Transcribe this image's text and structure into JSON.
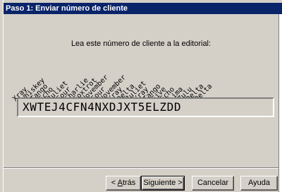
{
  "window": {
    "title": "Paso 1: Enviar número de cliente"
  },
  "instruction": "Lea este número de cliente a la editorial:",
  "phonetic_words": [
    "Xray",
    "Whiskey",
    "Tango",
    "Echo",
    "Juliet",
    "Four",
    "Charlie",
    "Foxtrot",
    "November",
    "Four",
    "November",
    "Xray",
    "Delta",
    "Juliet",
    "Xray",
    "Tango",
    "Five",
    "Echo",
    "Lima",
    "Zulu",
    "Delta",
    "Delta"
  ],
  "customer_code": "XWTEJ4CFN4NXDJXT5ELZDD",
  "buttons": {
    "back_prefix": "< ",
    "back_accel": "A",
    "back_rest": "trás",
    "next": "Siguiente >",
    "cancel": "Cancelar",
    "help": "Ayuda"
  }
}
